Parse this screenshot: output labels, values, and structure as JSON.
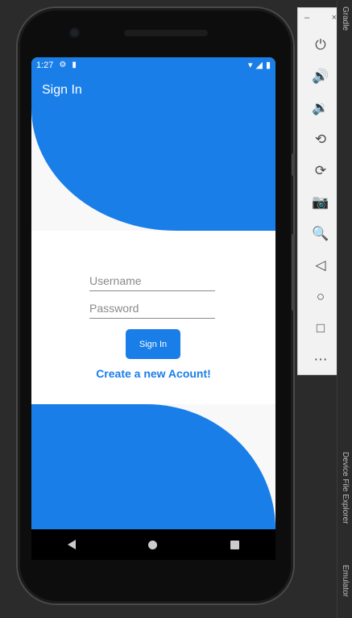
{
  "status_bar": {
    "time": "1:27",
    "icons": [
      "gear-icon",
      "sd-card-icon",
      "wifi-icon",
      "signal-icon",
      "battery-icon"
    ]
  },
  "app_bar": {
    "title": "Sign In"
  },
  "form": {
    "username_placeholder": "Username",
    "password_placeholder": "Password",
    "signin_label": "Sign In",
    "create_account_label": "Create a new Acount!"
  },
  "emulator_panel": {
    "minimize_label": "–",
    "close_label": "×",
    "buttons": [
      "power-icon",
      "volume-up-icon",
      "volume-down-icon",
      "rotate-left-icon",
      "rotate-right-icon",
      "camera-icon",
      "zoom-icon",
      "back-icon",
      "home-icon",
      "overview-icon",
      "more-icon"
    ]
  },
  "side_tabs": {
    "gradle": "Gradle",
    "device_file_explorer": "Device File Explorer",
    "emulator": "Emulator"
  },
  "colors": {
    "primary": "#1a7ee8",
    "background": "#2b2b2b"
  }
}
